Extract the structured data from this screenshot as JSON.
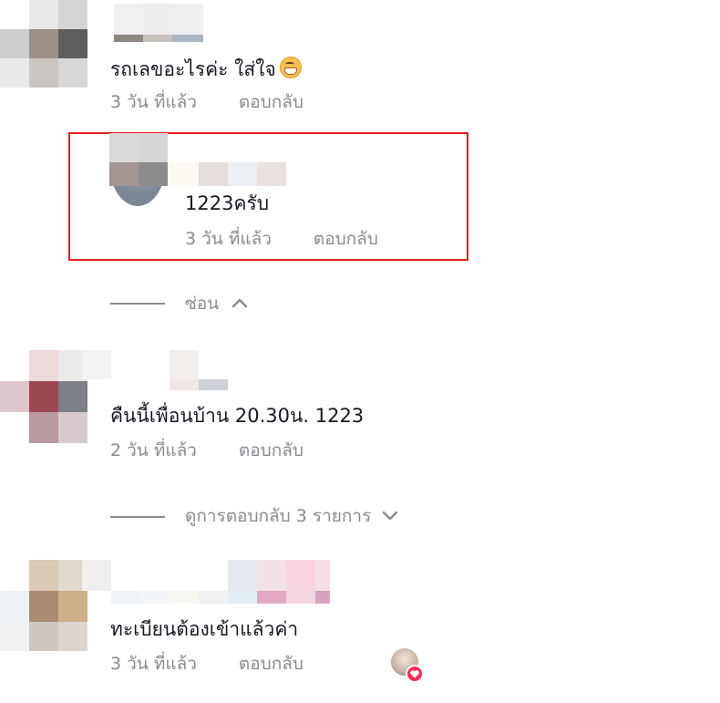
{
  "comments": [
    {
      "text": "รถเลขอะไรค่ะ ใส่ใจ",
      "time": "3 วัน ที่แล้ว",
      "reply_label": "ตอบกลับ",
      "emoji": "grinning-face-icon"
    },
    {
      "text": "1223ครับ",
      "time": "3 วัน ที่แล้ว",
      "reply_label": "ตอบกลับ"
    },
    {
      "text": "คืนนี้เพื่อนบ้าน 20.30น. 1223",
      "time": "2 วัน ที่แล้ว",
      "reply_label": "ตอบกลับ"
    },
    {
      "text": "ทะเบียนต้องเข้าแล้วค่า",
      "time": "3 วัน ที่แล้ว",
      "reply_label": "ตอบกลับ"
    }
  ],
  "hide_replies_label": "ซ่อน",
  "view_replies_label": "ดูการตอบกลับ 3 รายการ",
  "colors": {
    "highlight": "#e02020",
    "text": "#161823",
    "muted": "#8a8b91",
    "heart": "#fe2c55"
  }
}
